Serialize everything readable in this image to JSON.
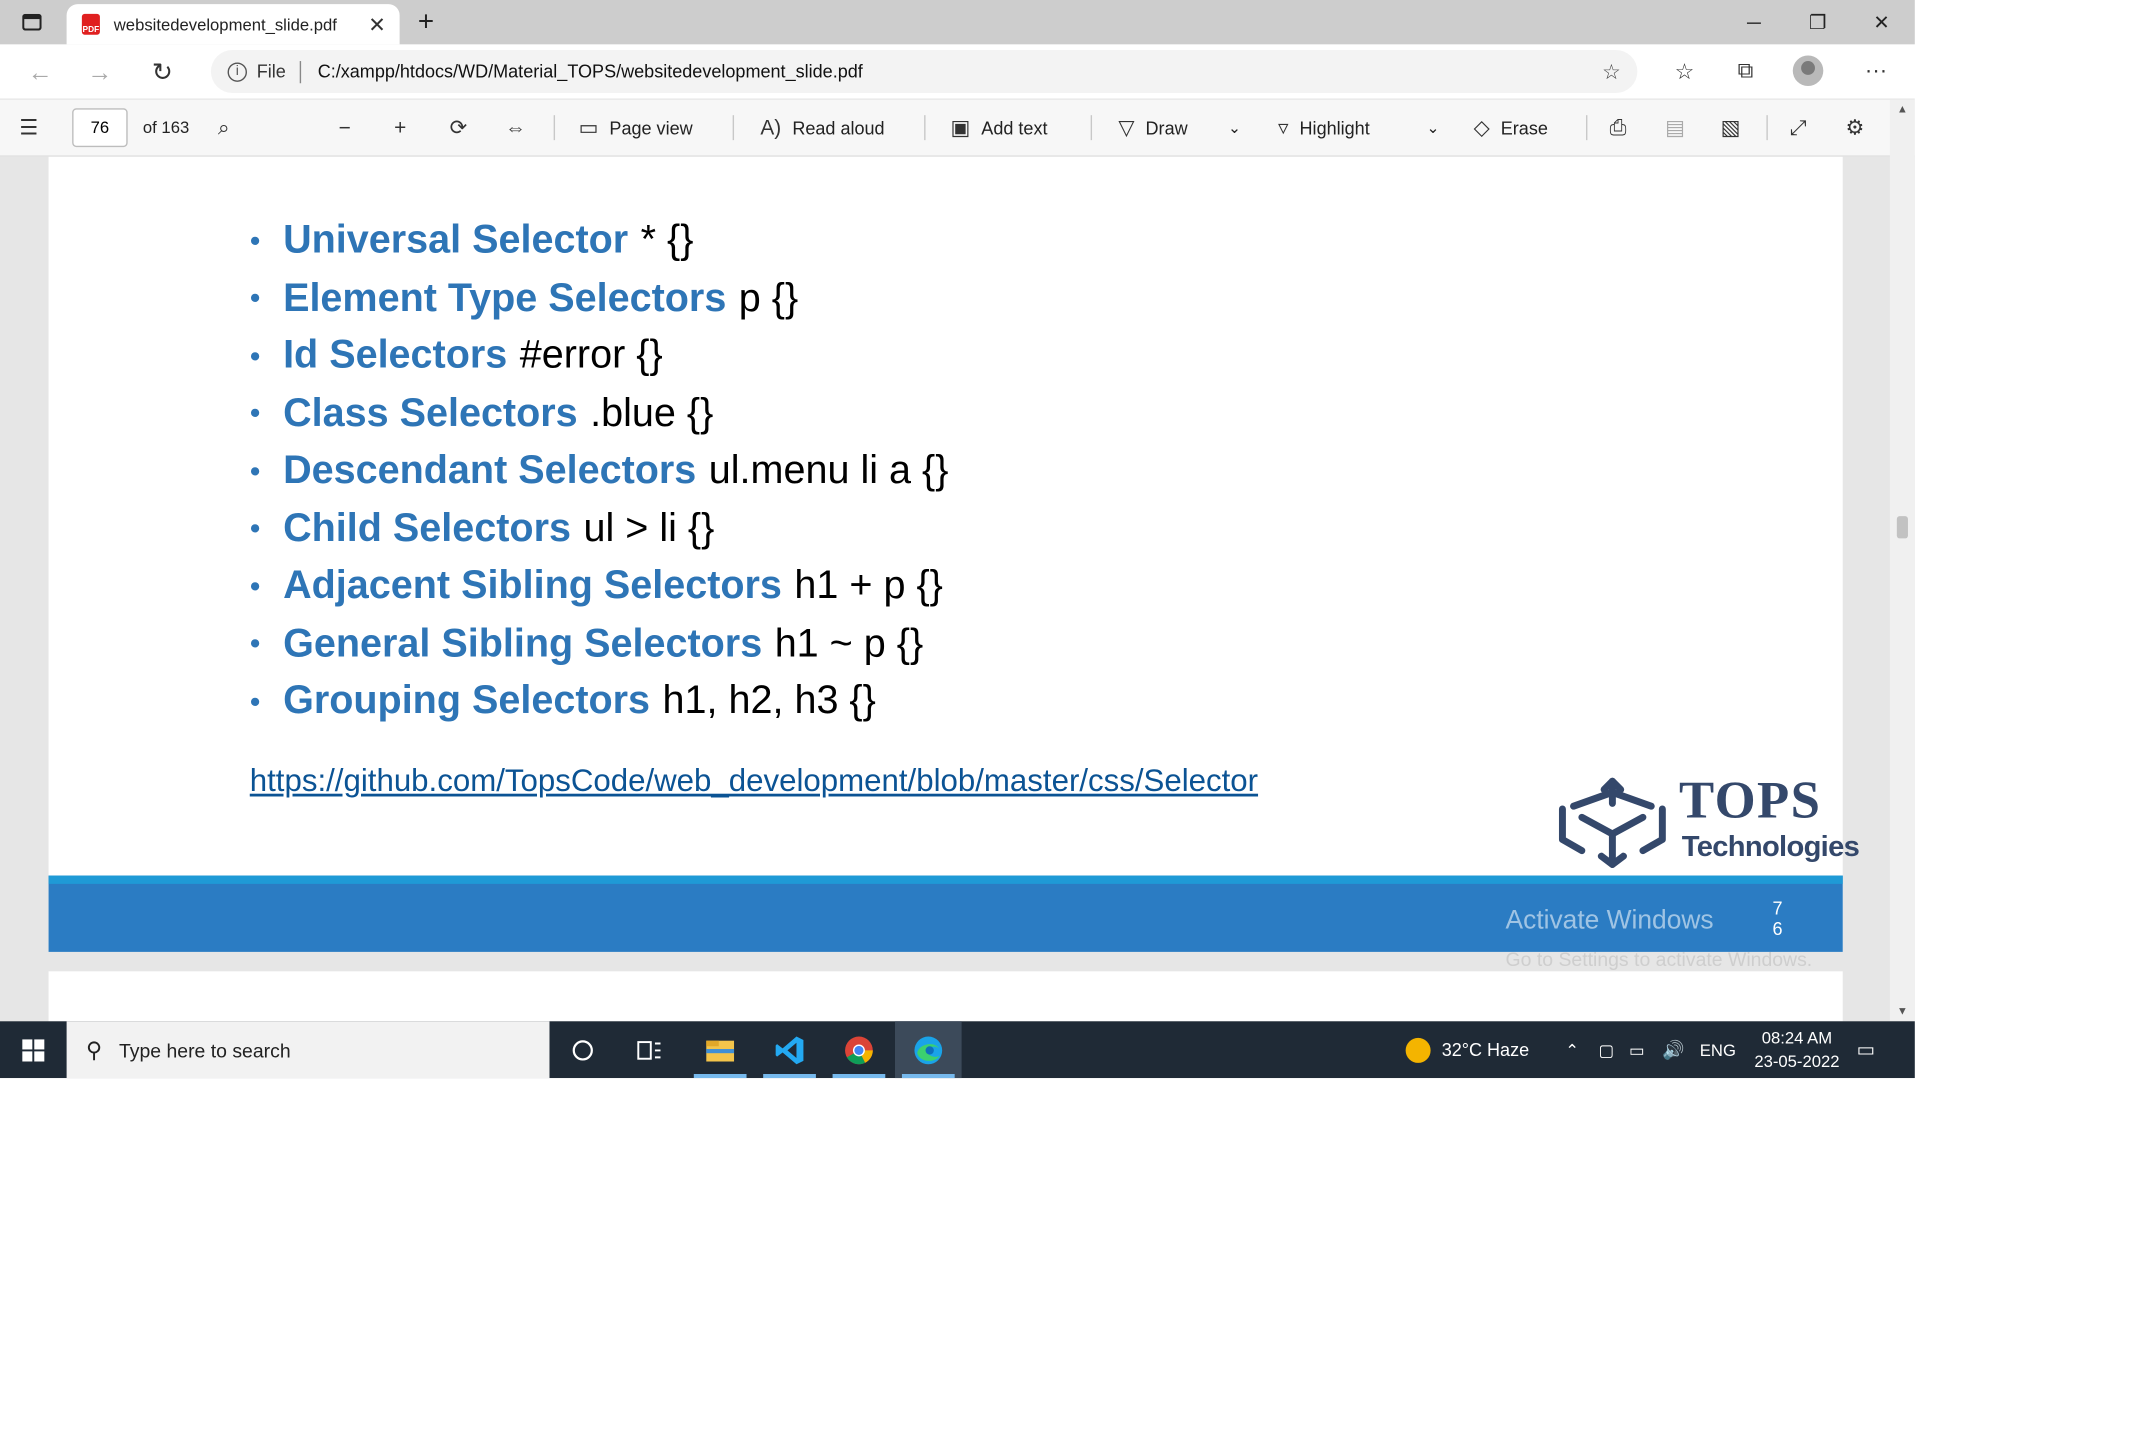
{
  "browser": {
    "tab_title": "websitedevelopment_slide.pdf",
    "address_protocol": "File",
    "address_url": "C:/xampp/htdocs/WD/Material_TOPS/websitedevelopment_slide.pdf"
  },
  "pdf_toolbar": {
    "page_number": "76",
    "page_total": "of 163",
    "page_view": "Page view",
    "read_aloud": "Read aloud",
    "add_text": "Add text",
    "draw": "Draw",
    "highlight": "Highlight",
    "erase": "Erase"
  },
  "slide": {
    "selectors": [
      {
        "name": "Universal Selector",
        "example": "* {}"
      },
      {
        "name": "Element Type Selectors",
        "example": "p {}"
      },
      {
        "name": "Id Selectors",
        "example": "#error {}"
      },
      {
        "name": "Class Selectors",
        "example": ".blue {}"
      },
      {
        "name": "Descendant Selectors",
        "example": "ul.menu li a {}"
      },
      {
        "name": "Child Selectors",
        "example": "ul > li {}"
      },
      {
        "name": "Adjacent Sibling Selectors",
        "example": "h1 + p {}"
      },
      {
        "name": "General Sibling Selectors",
        "example": "h1 ~ p {}"
      },
      {
        "name": "Grouping Selectors",
        "example": "h1, h2, h3 {}"
      }
    ],
    "link": "https://github.com/TopsCode/web_development/blob/master/css/Selector",
    "logo_title": "TOPS",
    "logo_subtitle": "Technologies",
    "slide_number_line1": "7",
    "slide_number_line2": "6",
    "watermark_title": "Activate Windows",
    "watermark_subtitle": "Go to Settings to activate Windows."
  },
  "taskbar": {
    "search_placeholder": "Type here to search",
    "weather": "32°C  Haze",
    "language": "ENG",
    "time": "08:24 AM",
    "date": "23-05-2022"
  },
  "colors": {
    "accent_blue": "#2e75b6",
    "footer_blue": "#2b7cc3",
    "logo_navy": "#34486b",
    "taskbar": "#1f2a36"
  }
}
